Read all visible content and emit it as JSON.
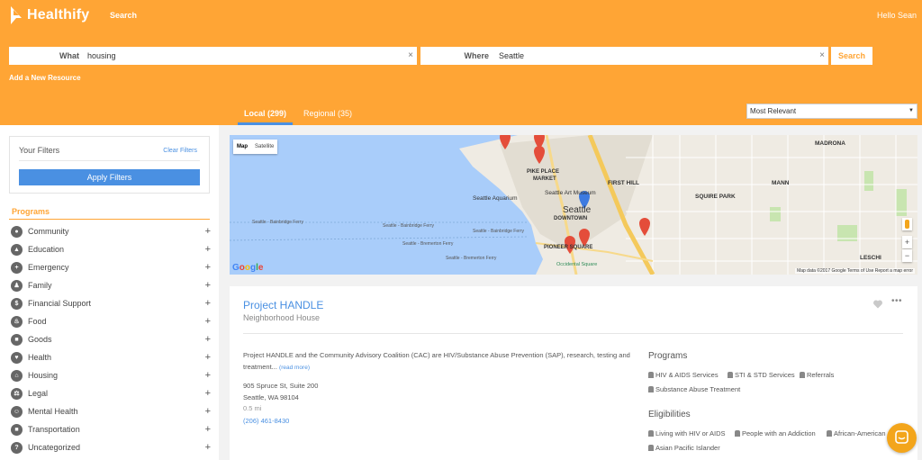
{
  "header": {
    "brand": "Healthify",
    "nav_search": "Search",
    "greeting": "Hello Sean"
  },
  "search": {
    "what_label": "What",
    "what_value": "housing",
    "where_label": "Where",
    "where_value": "Seattle",
    "button": "Search",
    "add_resource": "Add a New Resource"
  },
  "tabs": {
    "local": "Local (299)",
    "regional": "Regional (35)"
  },
  "sort": {
    "selected": "Most Relevant"
  },
  "filters": {
    "title": "Your Filters",
    "clear": "Clear Filters",
    "apply": "Apply Filters",
    "programs_heading": "Programs",
    "categories": [
      {
        "label": "Community",
        "icon": "group-icon"
      },
      {
        "label": "Education",
        "icon": "graduation-cap-icon"
      },
      {
        "label": "Emergency",
        "icon": "ambulance-icon"
      },
      {
        "label": "Family",
        "icon": "family-icon"
      },
      {
        "label": "Financial Support",
        "icon": "dollar-icon"
      },
      {
        "label": "Food",
        "icon": "food-icon"
      },
      {
        "label": "Goods",
        "icon": "basket-icon"
      },
      {
        "label": "Health",
        "icon": "health-icon"
      },
      {
        "label": "Housing",
        "icon": "house-icon"
      },
      {
        "label": "Legal",
        "icon": "gavel-icon"
      },
      {
        "label": "Mental Health",
        "icon": "brain-icon"
      },
      {
        "label": "Transportation",
        "icon": "bus-icon"
      },
      {
        "label": "Uncategorized",
        "icon": "question-icon"
      }
    ]
  },
  "map": {
    "tab_map": "Map",
    "tab_satellite": "Satellite",
    "labels": {
      "pike_place": "PIKE PLACE",
      "market": "MARKET",
      "art_museum": "Seattle Art Museum",
      "aquarium": "Seattle Aquarium",
      "seattle": "Seattle",
      "downtown": "DOWNTOWN",
      "first_hill": "FIRST HILL",
      "squire_park": "SQUIRE PARK",
      "madrona": "MADRONA",
      "mann": "MANN",
      "leschi": "LESCHI",
      "pioneer": "PIONEER SQUARE",
      "occidental": "Occidental Square",
      "ferry1": "Seattle - Bainbridge Ferry",
      "ferry2": "Seattle - Bainbridge Ferry",
      "ferry3": "Seattle - Bremerton Ferry",
      "ferry4": "Seattle - Bainbridge Ferry",
      "ferry5": "Seattle - Bremerton Ferry"
    },
    "google": "Google",
    "footer": "Map data ©2017 Google   Terms of Use   Report a map error",
    "zoom_in": "+",
    "zoom_out": "−"
  },
  "result": {
    "title": "Project HANDLE",
    "org": "Neighborhood House",
    "description": "Project HANDLE and the Community Advisory Coalition (CAC) are HIV/Substance Abuse Prevention (SAP), research, testing and treatment...",
    "read_more": "(read more)",
    "address1": "905 Spruce St, Suite 200",
    "address2": "Seattle, WA 98104",
    "distance": "0.5 mi",
    "phone": "(206) 461-8430",
    "programs_heading": "Programs",
    "programs": [
      "HIV & AIDS Services",
      "STI & STD Services",
      "Referrals",
      "Substance Abuse Treatment"
    ],
    "eligibilities_heading": "Eligibilities",
    "eligibilities": [
      "Living with HIV or AIDS",
      "People with an Addiction",
      "African-American",
      "Asian Pacific Islander"
    ]
  },
  "colors": {
    "brand_orange": "#ffa535",
    "accent_blue": "#4a90e2"
  }
}
